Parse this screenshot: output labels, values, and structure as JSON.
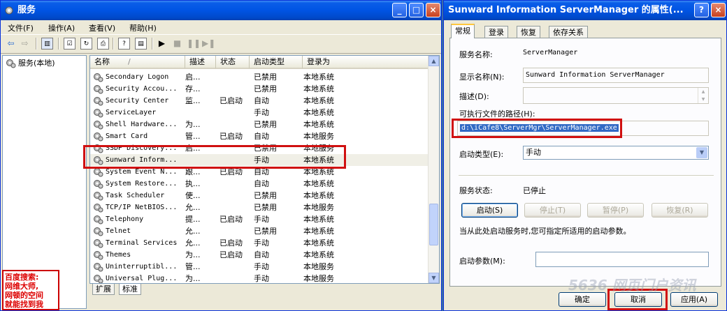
{
  "services_window": {
    "title": "服务",
    "menu": [
      "文件(F)",
      "操作(A)",
      "查看(V)",
      "帮助(H)"
    ],
    "tree_root": "服务(本地)",
    "columns": {
      "name": "名称",
      "sort_glyph": "/",
      "desc": "描述",
      "status": "状态",
      "startup": "启动类型",
      "logon": "登录为"
    },
    "rows": [
      {
        "name": "Secondary Logon",
        "desc": "启...",
        "status": "",
        "startup": "已禁用",
        "logon": "本地系统"
      },
      {
        "name": "Security Accou...",
        "desc": "存...",
        "status": "",
        "startup": "已禁用",
        "logon": "本地系统"
      },
      {
        "name": "Security Center",
        "desc": "监...",
        "status": "已启动",
        "startup": "自动",
        "logon": "本地系统"
      },
      {
        "name": "ServiceLayer",
        "desc": "",
        "status": "",
        "startup": "手动",
        "logon": "本地系统"
      },
      {
        "name": "Shell Hardware...",
        "desc": "为...",
        "status": "",
        "startup": "已禁用",
        "logon": "本地系统"
      },
      {
        "name": "Smart Card",
        "desc": "管...",
        "status": "已启动",
        "startup": "自动",
        "logon": "本地服务"
      },
      {
        "name": "SSDP Discovery...",
        "desc": "启...",
        "status": "",
        "startup": "已禁用",
        "logon": "本地服务"
      },
      {
        "name": "Sunward Inform...",
        "desc": "",
        "status": "",
        "startup": "手动",
        "logon": "本地系统"
      },
      {
        "name": "System Event N...",
        "desc": "跟...",
        "status": "已启动",
        "startup": "自动",
        "logon": "本地系统"
      },
      {
        "name": "System Restore...",
        "desc": "执...",
        "status": "",
        "startup": "自动",
        "logon": "本地系统"
      },
      {
        "name": "Task Scheduler",
        "desc": "使...",
        "status": "",
        "startup": "已禁用",
        "logon": "本地系统"
      },
      {
        "name": "TCP/IP NetBIOS...",
        "desc": "允...",
        "status": "",
        "startup": "已禁用",
        "logon": "本地服务"
      },
      {
        "name": "Telephony",
        "desc": "提...",
        "status": "已启动",
        "startup": "手动",
        "logon": "本地系统"
      },
      {
        "name": "Telnet",
        "desc": "允...",
        "status": "",
        "startup": "已禁用",
        "logon": "本地系统"
      },
      {
        "name": "Terminal Services",
        "desc": "允...",
        "status": "已启动",
        "startup": "手动",
        "logon": "本地系统"
      },
      {
        "name": "Themes",
        "desc": "为...",
        "status": "已启动",
        "startup": "自动",
        "logon": "本地系统"
      },
      {
        "name": "Uninterruptibl...",
        "desc": "管...",
        "status": "",
        "startup": "手动",
        "logon": "本地服务"
      },
      {
        "name": "Universal Plug...",
        "desc": "为...",
        "status": "",
        "startup": "手动",
        "logon": "本地服务"
      }
    ],
    "tabs": [
      "扩展",
      "标准"
    ],
    "watermark": [
      "百度搜索:",
      "网维大师,",
      "网顿的空间",
      "就能找到我"
    ]
  },
  "properties_dialog": {
    "title": "Sunward Information ServerManager 的属性(...",
    "tabs": [
      "常规",
      "登录",
      "恢复",
      "依存关系"
    ],
    "service_name_label": "服务名称:",
    "service_name": "ServerManager",
    "display_name_label": "显示名称(N):",
    "display_name": "Sunward Information ServerManager",
    "description_label": "描述(D):",
    "description": "",
    "path_label": "可执行文件的路径(H):",
    "path": "d:\\iCafe8\\ServerMgr\\ServerManager.exe",
    "startup_type_label": "启动类型(E):",
    "startup_type": "手动",
    "status_label": "服务状态:",
    "status": "已停止",
    "buttons": {
      "start": "启动(S)",
      "stop": "停止(T)",
      "pause": "暂停(P)",
      "resume": "恢复(R)"
    },
    "hint": "当从此处启动服务时,您可指定所适用的启动参数。",
    "params_label": "启动参数(M):",
    "params": "",
    "footer": {
      "ok": "确定",
      "cancel": "取消",
      "apply": "应用(A)"
    },
    "site_watermark": "5636 网页门户资讯"
  },
  "colors": {
    "title_blue": "#0054e3",
    "highlight": "#316ac5",
    "frame_red": "#d01010"
  }
}
